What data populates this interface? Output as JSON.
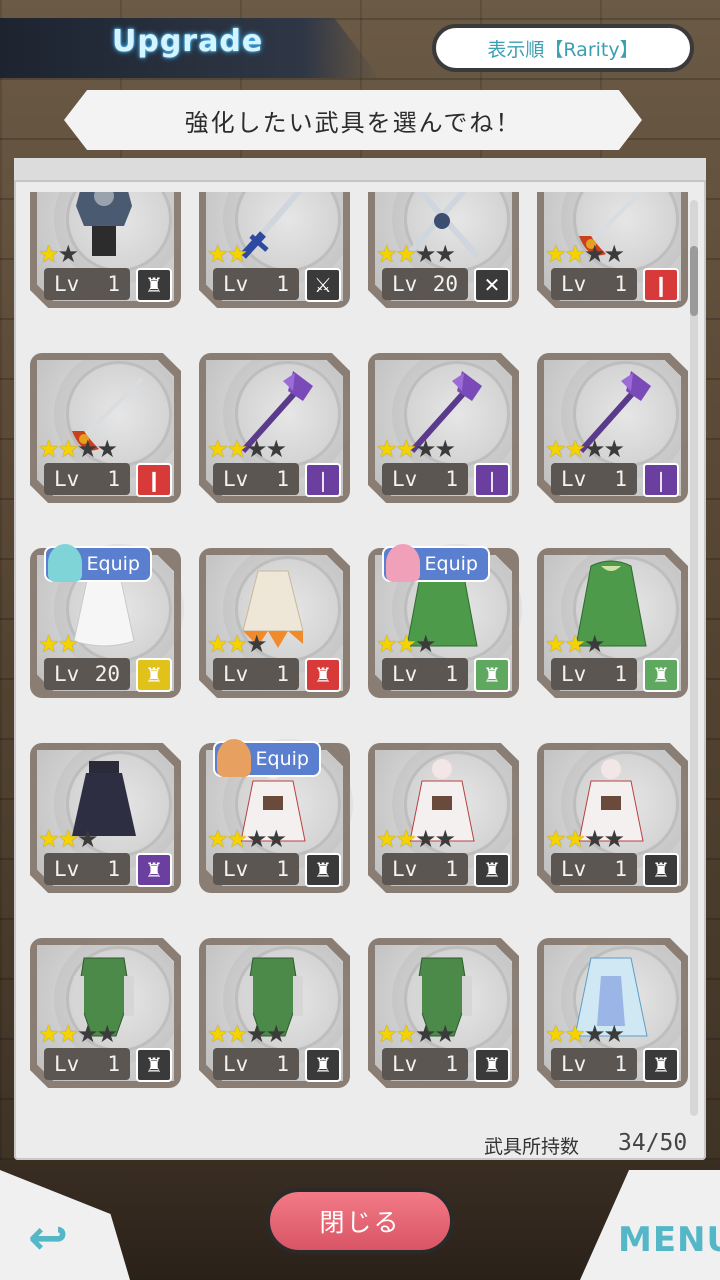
{
  "header": {
    "title": "Upgrade",
    "sort_label": "表示順【Rarity】"
  },
  "instruction": "強化したい武具を選んでね！",
  "equip_label": "Equip",
  "lv_label": "Lv",
  "items": [
    {
      "lv": "1",
      "stars": 1,
      "max": 2,
      "type": "armor",
      "tcolor": "#3a3a3a",
      "art": "armor-dark"
    },
    {
      "lv": "1",
      "stars": 2,
      "max": 2,
      "type": "sword",
      "tcolor": "#3a3a3a",
      "art": "sword-blue"
    },
    {
      "lv": "20",
      "stars": 2,
      "max": 4,
      "type": "dual",
      "tcolor": "#3a3a3a",
      "art": "dual-swords"
    },
    {
      "lv": "1",
      "stars": 2,
      "max": 4,
      "type": "rapier",
      "tcolor": "#d83a3a",
      "art": "rapier"
    },
    {
      "lv": "1",
      "stars": 2,
      "max": 4,
      "type": "rapier",
      "tcolor": "#d83a3a",
      "art": "rapier"
    },
    {
      "lv": "1",
      "stars": 2,
      "max": 4,
      "type": "staff",
      "tcolor": "#6a3fa0",
      "art": "staff"
    },
    {
      "lv": "1",
      "stars": 2,
      "max": 4,
      "type": "staff",
      "tcolor": "#6a3fa0",
      "art": "staff"
    },
    {
      "lv": "1",
      "stars": 2,
      "max": 4,
      "type": "staff",
      "tcolor": "#6a3fa0",
      "art": "staff"
    },
    {
      "lv": "20",
      "stars": 2,
      "max": 2,
      "type": "armor",
      "tcolor": "#e0c21a",
      "art": "cloak-white",
      "equip": "sinon"
    },
    {
      "lv": "1",
      "stars": 2,
      "max": 3,
      "type": "armor",
      "tcolor": "#d83a3a",
      "art": "skirt-flame"
    },
    {
      "lv": "1",
      "stars": 2,
      "max": 3,
      "type": "armor",
      "tcolor": "#5fa85f",
      "art": "coat-green",
      "equip": "lisbeth"
    },
    {
      "lv": "1",
      "stars": 2,
      "max": 3,
      "type": "armor",
      "tcolor": "#5fa85f",
      "art": "coat-green"
    },
    {
      "lv": "1",
      "stars": 2,
      "max": 3,
      "type": "armor",
      "tcolor": "#6a3fa0",
      "art": "skirt-dark"
    },
    {
      "lv": "1",
      "stars": 2,
      "max": 4,
      "type": "armor",
      "tcolor": "#3a3a3a",
      "art": "dress-white",
      "equip": "asuna"
    },
    {
      "lv": "1",
      "stars": 2,
      "max": 4,
      "type": "armor",
      "tcolor": "#3a3a3a",
      "art": "dress-white"
    },
    {
      "lv": "1",
      "stars": 2,
      "max": 4,
      "type": "armor",
      "tcolor": "#3a3a3a",
      "art": "dress-white"
    },
    {
      "lv": "1",
      "stars": 2,
      "max": 4,
      "type": "armor",
      "tcolor": "#3a3a3a",
      "art": "armor-green"
    },
    {
      "lv": "1",
      "stars": 2,
      "max": 4,
      "type": "armor",
      "tcolor": "#3a3a3a",
      "art": "armor-green"
    },
    {
      "lv": "1",
      "stars": 2,
      "max": 4,
      "type": "armor",
      "tcolor": "#3a3a3a",
      "art": "armor-green"
    },
    {
      "lv": "1",
      "stars": 2,
      "max": 4,
      "type": "armor",
      "tcolor": "#3a3a3a",
      "art": "dress-blue"
    }
  ],
  "footer": {
    "count_label": "武具所持数",
    "count_value": "34/50"
  },
  "close_label": "閉じる",
  "menu_label": "MENU",
  "colors": {
    "accent": "#54b7c7",
    "close_button": "#e26573",
    "equip_badge": "#5b7fcf",
    "star": "#f4d300"
  }
}
